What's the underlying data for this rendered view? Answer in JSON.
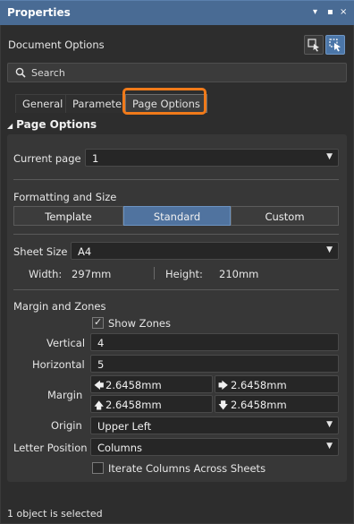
{
  "window": {
    "title": "Properties",
    "controls": [
      "▾",
      "▪",
      "×"
    ]
  },
  "header": {
    "label": "Document Options"
  },
  "search": {
    "placeholder": "Search"
  },
  "tabs": [
    {
      "label": "General"
    },
    {
      "label": "Parameters"
    },
    {
      "label": "Page Options",
      "active": true
    }
  ],
  "section": {
    "title": "Page Options"
  },
  "current_page": {
    "label": "Current page",
    "value": "1"
  },
  "formatting": {
    "title": "Formatting and Size",
    "modes": [
      {
        "label": "Template"
      },
      {
        "label": "Standard",
        "active": true
      },
      {
        "label": "Custom"
      }
    ]
  },
  "sheet": {
    "label": "Sheet Size",
    "value": "A4",
    "width_label": "Width:",
    "width_value": "297mm",
    "height_label": "Height:",
    "height_value": "210mm"
  },
  "margins": {
    "title": "Margin and Zones",
    "show_zones_label": "Show Zones",
    "show_zones_checked": true,
    "vertical_label": "Vertical",
    "vertical_value": "4",
    "horizontal_label": "Horizontal",
    "horizontal_value": "5",
    "margin_label": "Margin",
    "margin_left": "2.6458mm",
    "margin_right": "2.6458mm",
    "margin_top": "2.6458mm",
    "margin_bottom": "2.6458mm",
    "origin_label": "Origin",
    "origin_value": "Upper Left",
    "letter_position_label": "Letter Position",
    "letter_position_value": "Columns",
    "iterate_label": "Iterate Columns Across Sheets",
    "iterate_checked": false
  },
  "status": {
    "text": "1 object is selected"
  },
  "colors": {
    "titlebar": "#496b94",
    "accent": "#50739f",
    "highlight": "#f07a1a"
  }
}
